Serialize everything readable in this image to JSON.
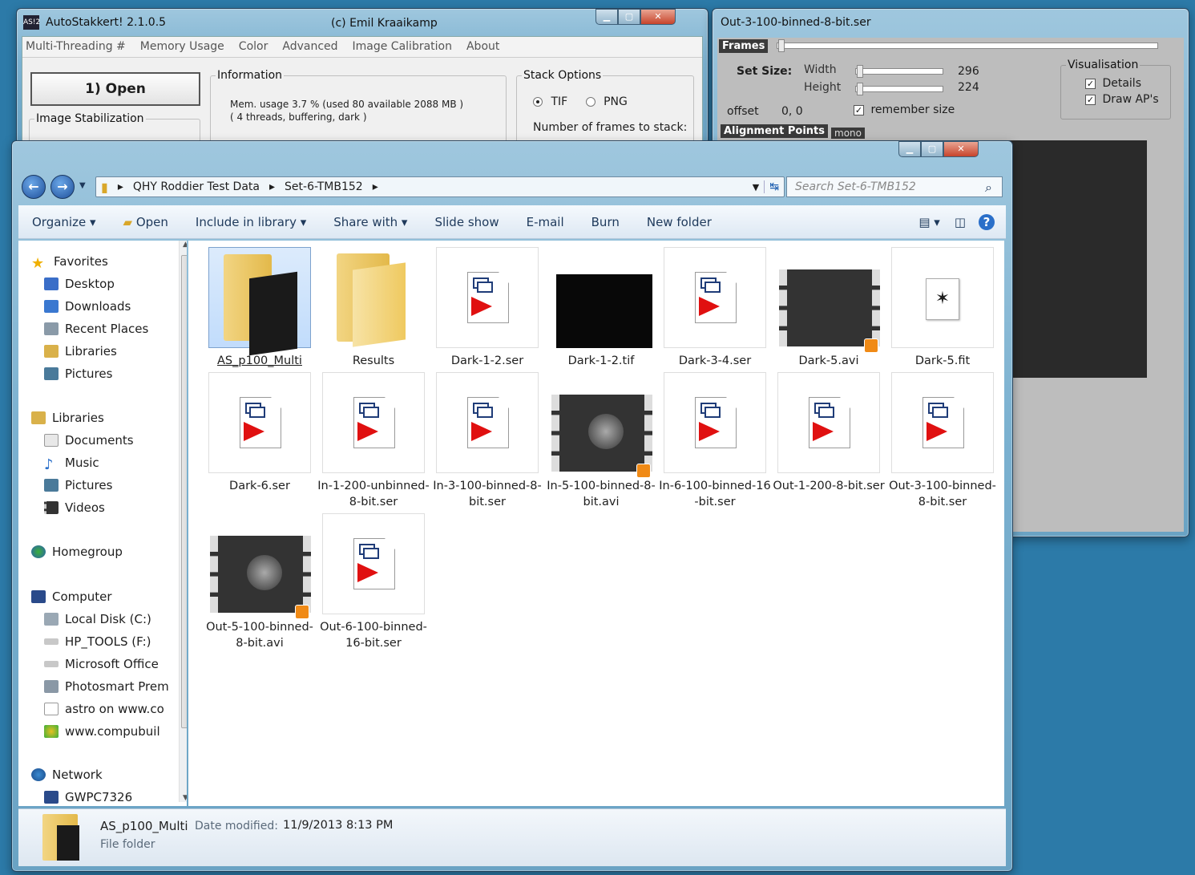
{
  "autostakkert": {
    "title": "AutoStakkert! 2.1.0.5",
    "copyright": "(c) Emil Kraaikamp",
    "menu": [
      "Multi-Threading #",
      "Memory Usage",
      "Color",
      "Advanced",
      "Image Calibration",
      "About"
    ],
    "open_label": "1) Open",
    "image_stabilization_label": "Image Stabilization",
    "information_label": "Information",
    "mem_line1": "Mem. usage 3.7 %  (used 80 available 2088 MB )",
    "mem_line2": "( 4 threads, buffering, dark  )",
    "stack_options_label": "Stack Options",
    "tif_label": "TIF",
    "png_label": "PNG",
    "frames_to_stack_label": "Number of frames to stack:"
  },
  "ser": {
    "title": "Out-3-100-binned-8-bit.ser",
    "frames_label": "Frames",
    "set_size_label": "Set Size:",
    "width_label": "Width",
    "height_label": "Height",
    "width_value": "296",
    "height_value": "224",
    "offset_label": "offset",
    "offset_value": "0, 0",
    "remember_size_label": "remember size",
    "visualisation_label": "Visualisation",
    "details_label": "Details",
    "draw_aps_label": "Draw AP's",
    "alignment_points_label": "Alignment Points",
    "mono_label": "mono"
  },
  "explorer": {
    "breadcrumb": [
      "QHY Roddier Test Data",
      "Set-6-TMB152"
    ],
    "search_placeholder": "Search Set-6-TMB152",
    "commands": [
      "Organize ▾",
      "Open",
      "Include in library ▾",
      "Share with ▾",
      "Slide show",
      "E-mail",
      "Burn",
      "New folder"
    ],
    "nav": {
      "favorites": "Favorites",
      "desktop": "Desktop",
      "downloads": "Downloads",
      "recent_places": "Recent Places",
      "fav_libraries": "Libraries",
      "fav_pictures": "Pictures",
      "libraries": "Libraries",
      "documents": "Documents",
      "music": "Music",
      "pictures": "Pictures",
      "videos": "Videos",
      "homegroup": "Homegroup",
      "computer": "Computer",
      "local_disk": "Local Disk (C:)",
      "hp_tools": "HP_TOOLS (F:)",
      "ms_office": "Microsoft Office",
      "photosmart": "Photosmart Prem",
      "astro": "astro on www.co",
      "compubuil": "www.compubuil",
      "network": "Network",
      "gwpc": "GWPC7326"
    },
    "files": [
      {
        "name": "AS_p100_Multi",
        "kind": "folder"
      },
      {
        "name": "Results",
        "kind": "folder"
      },
      {
        "name": "Dark-1-2.ser",
        "kind": "ser"
      },
      {
        "name": "Dark-1-2.tif",
        "kind": "black"
      },
      {
        "name": "Dark-3-4.ser",
        "kind": "ser"
      },
      {
        "name": "Dark-5.avi",
        "kind": "video-dark"
      },
      {
        "name": "Dark-5.fit",
        "kind": "fit"
      },
      {
        "name": "Dark-6.ser",
        "kind": "ser"
      },
      {
        "name": "In-1-200-unbinned-8-bit.ser",
        "kind": "ser"
      },
      {
        "name": "In-3-100-binned-8-bit.ser",
        "kind": "ser"
      },
      {
        "name": "In-5-100-binned-8-bit.avi",
        "kind": "video"
      },
      {
        "name": "In-6-100-binned-16-bit.ser",
        "kind": "ser"
      },
      {
        "name": "Out-1-200-8-bit.ser",
        "kind": "ser"
      },
      {
        "name": "Out-3-100-binned-8-bit.ser",
        "kind": "ser"
      },
      {
        "name": "Out-5-100-binned-8-bit.avi",
        "kind": "video"
      },
      {
        "name": "Out-6-100-binned-16-bit.ser",
        "kind": "ser"
      }
    ],
    "details": {
      "name": "AS_p100_Multi",
      "date_label": "Date modified:",
      "date_value": "11/9/2013 8:13 PM",
      "type": "File folder"
    }
  }
}
